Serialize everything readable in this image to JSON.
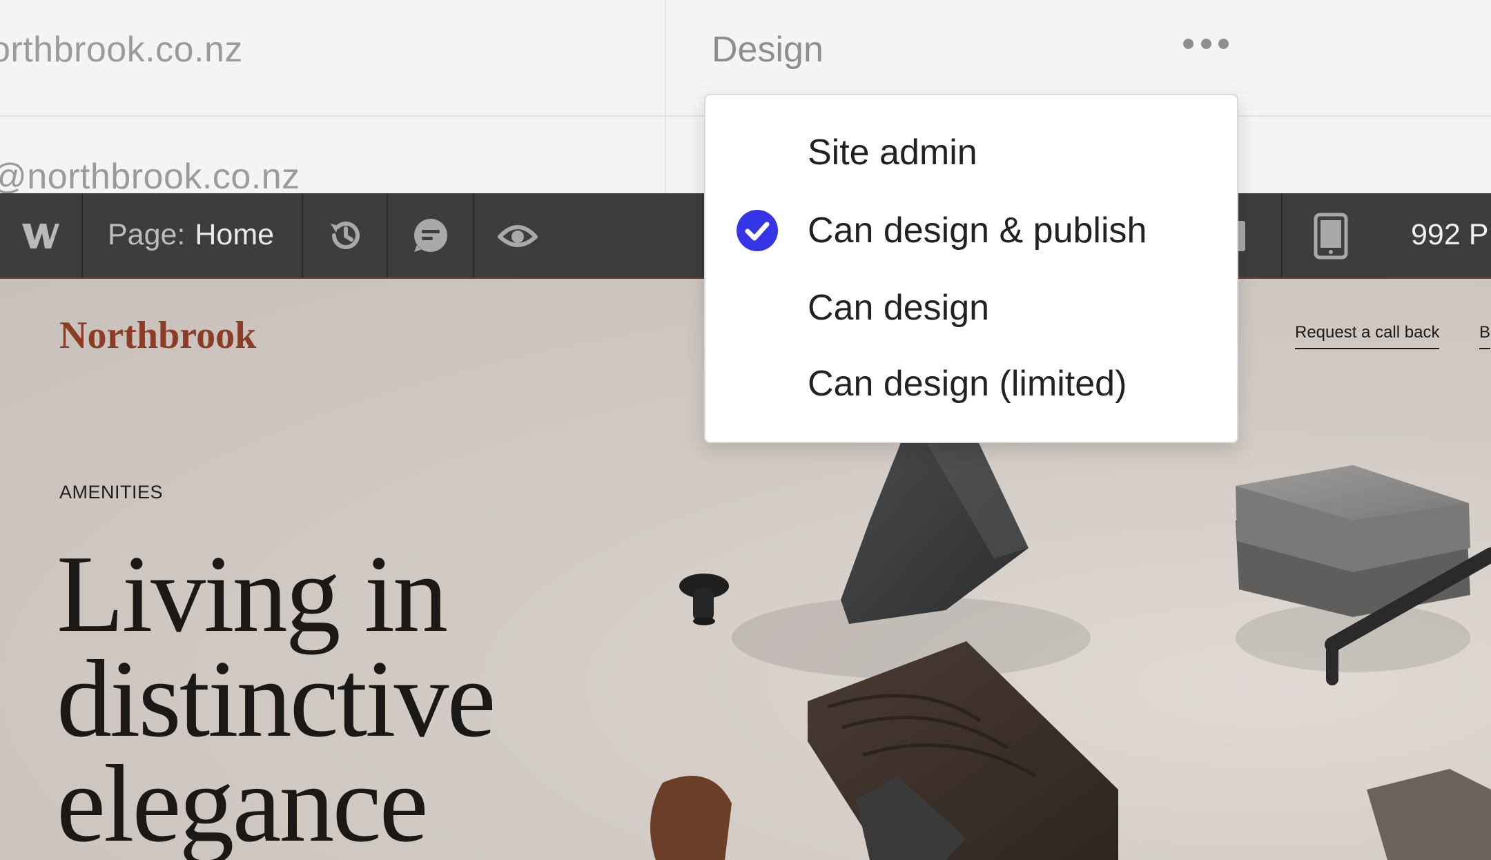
{
  "members": {
    "rows": [
      {
        "email": "orthbrook.co.nz"
      },
      {
        "email": "@northbrook.co.nz"
      }
    ],
    "role_value": "Design"
  },
  "toolbar": {
    "logo": "W",
    "page_label": "Page:",
    "page_name": "Home",
    "width_readout": "992 P",
    "icons": [
      "webflow-logo-icon",
      "history-icon",
      "comment-icon",
      "preview-eye-icon",
      "tablet-icon"
    ]
  },
  "role_menu": {
    "selected_index": 1,
    "accent_color": "#3535e6",
    "options": [
      {
        "label": "Site admin"
      },
      {
        "label": "Can design & publish"
      },
      {
        "label": "Can design"
      },
      {
        "label": "Can design (limited)"
      }
    ]
  },
  "site": {
    "brand": "Northbrook",
    "brand_color": "#8c3d26",
    "nav": [
      "Request a call back",
      "B"
    ],
    "eyebrow": "AMENITIES",
    "hero_title": "Living in distinctive elegance"
  }
}
